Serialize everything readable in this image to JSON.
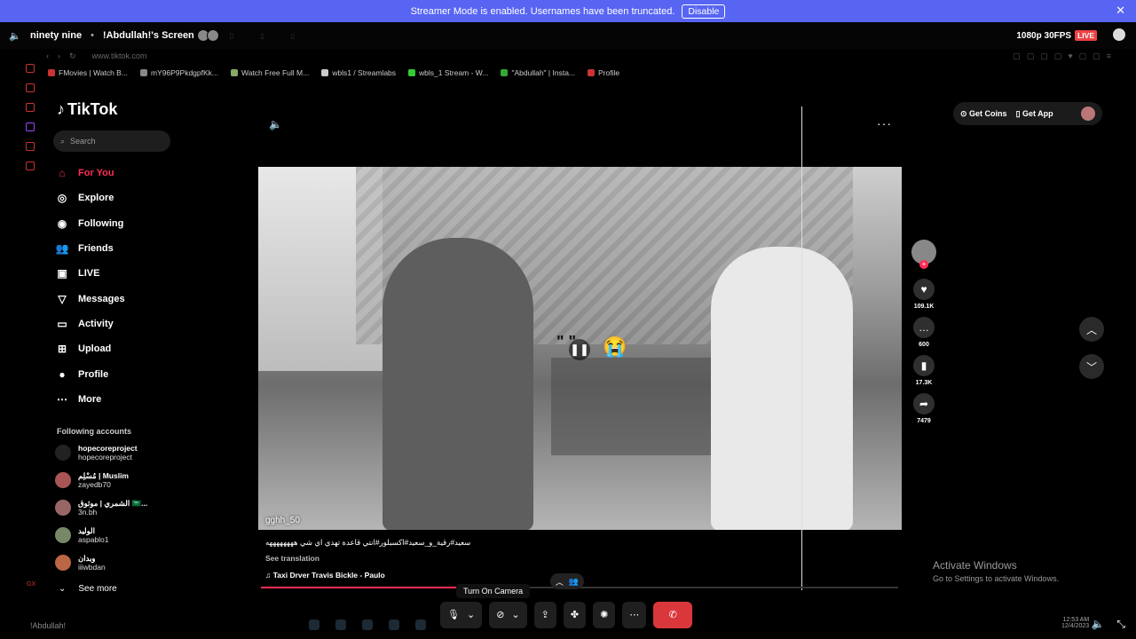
{
  "banner": {
    "text": "Streamer Mode is enabled. Usernames have been truncated.",
    "button": "Disable"
  },
  "header": {
    "channel": "ninety nine",
    "screen_title": "!Abdullah!'s Screen",
    "quality": "1080p 30FPS",
    "live": "LIVE"
  },
  "browser": {
    "url": "www.tiktok.com",
    "bookmarks": [
      "FMovies | Watch B...",
      "mY96P9PkdgpfKk...",
      "Watch Free Full M...",
      "wbls1 / Streamlabs",
      "wbls_1 Stream - W...",
      "\"Abdullah\" | Insta...",
      "Profile"
    ]
  },
  "tiktok": {
    "logo": "TikTok",
    "search_placeholder": "Search",
    "nav": [
      {
        "label": "For You",
        "icon": "home-icon"
      },
      {
        "label": "Explore",
        "icon": "compass-icon"
      },
      {
        "label": "Following",
        "icon": "following-icon"
      },
      {
        "label": "Friends",
        "icon": "friends-icon"
      },
      {
        "label": "LIVE",
        "icon": "live-icon"
      },
      {
        "label": "Messages",
        "icon": "messages-icon"
      },
      {
        "label": "Activity",
        "icon": "activity-icon"
      },
      {
        "label": "Upload",
        "icon": "upload-icon"
      },
      {
        "label": "Profile",
        "icon": "profile-icon"
      },
      {
        "label": "More",
        "icon": "more-icon"
      }
    ],
    "following_title": "Following accounts",
    "accounts": [
      {
        "name": "hopecoreproject",
        "user": "hopecoreproject"
      },
      {
        "name": "مُسْلِم | Muslim",
        "user": "zayedb70"
      },
      {
        "name": "الشمري | موثوق 🇸🇦...",
        "user": "3n.bh"
      },
      {
        "name": "الوليد",
        "user": "aspablo1"
      },
      {
        "name": "وبدان",
        "user": "iiiwbdan"
      }
    ],
    "see_more": "See more",
    "video": {
      "username": "gghh_50",
      "overlay_text": "\" \"",
      "caption": "سعيد#رقية_و_سعيد#اكسبلور#انتي قاعدة تهدي اي شي ههههههههه",
      "see_translation": "See translation",
      "music": "Taxi Drver Travis Bickle - Paulo",
      "progress": 0.42
    },
    "actions": {
      "likes": "109.1K",
      "comments": "600",
      "saves": "17.3K",
      "shares": "7479"
    },
    "top_right": {
      "coins": "Get Coins",
      "app": "Get App"
    }
  },
  "activate": {
    "title": "Activate Windows",
    "sub": "Go to Settings to activate Windows."
  },
  "controls": {
    "tooltip": "Turn On Camera"
  },
  "taskbar": {
    "user": "!Abdullah!",
    "time": "12:53 AM",
    "date": "12/4/2023"
  }
}
